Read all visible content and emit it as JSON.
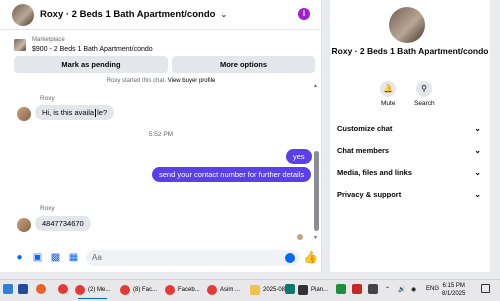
{
  "chat": {
    "title": "Roxy · 2 Beds 1 Bath Apartment/condo",
    "listing": {
      "source": "Marketplace",
      "price_line": "$900 - 2 Beds 1 Bath Apartment/condo"
    },
    "buttons": {
      "mark_pending": "Mark as pending",
      "more_options": "More options"
    },
    "started_text": "Roxy started this chat.",
    "view_profile": "View buyer profile",
    "messages": [
      {
        "from": "Roxy",
        "direction": "incoming",
        "text_a": "Hi, is this availa",
        "text_b": "le?"
      },
      {
        "direction": "outgoing",
        "text": "yes"
      },
      {
        "direction": "outgoing",
        "text": "send your contact number for further details"
      },
      {
        "from": "Roxy",
        "direction": "incoming",
        "text": "4847734670"
      }
    ],
    "timestamp": "5:52 PM",
    "composer_placeholder": "Aa",
    "accent_color": "#5b40e9"
  },
  "side": {
    "title": "Roxy · 2 Beds 1 Bath Apartment/condo",
    "mute_label": "Mute",
    "search_label": "Search",
    "sections": [
      "Customize chat",
      "Chat members",
      "Media, files and links",
      "Privacy & support"
    ]
  },
  "taskbar": {
    "apps": [
      "(2) Me...",
      "(8) Fac...",
      "Faceb...",
      "Asim ...",
      "2025-08",
      "Pian..."
    ],
    "lang": "ENG",
    "time": "6:15 PM",
    "date": "8/1/2025"
  }
}
